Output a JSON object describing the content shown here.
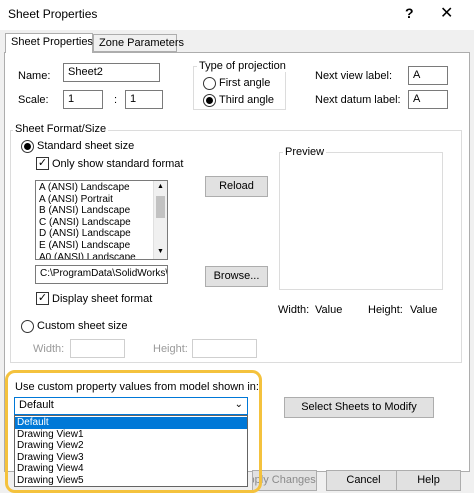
{
  "window": {
    "title": "Sheet Properties",
    "help_glyph": "?",
    "close_glyph": "✕"
  },
  "tabs": [
    {
      "label": "Sheet Properties"
    },
    {
      "label": "Zone Parameters"
    }
  ],
  "name": {
    "label": "Name:",
    "value": "Sheet2"
  },
  "scale": {
    "label": "Scale:",
    "numerator": "1",
    "separator": ":",
    "denominator": "1"
  },
  "projection": {
    "title": "Type of projection",
    "first_angle": "First angle",
    "third_angle": "Third angle"
  },
  "next_view": {
    "label": "Next view label:",
    "value": "A"
  },
  "next_datum": {
    "label": "Next datum label:",
    "value": "A"
  },
  "sheet_format": {
    "title": "Sheet Format/Size",
    "standard_size": "Standard sheet size",
    "only_standard": "Only show standard format",
    "sizes": [
      "A (ANSI) Landscape",
      "A (ANSI) Portrait",
      "B (ANSI) Landscape",
      "C (ANSI) Landscape",
      "D (ANSI) Landscape",
      "E (ANSI) Landscape",
      "A0 (ANSI) Landscape"
    ],
    "reload": "Reload",
    "path": "C:\\ProgramData\\SolidWorks\\",
    "browse": "Browse...",
    "display_format": "Display sheet format",
    "custom_size": "Custom sheet size",
    "width_label": "Width:",
    "height_label": "Height:"
  },
  "preview": {
    "title": "Preview",
    "width_label": "Width:",
    "width_value": "Value",
    "height_label": "Height:",
    "height_value": "Value"
  },
  "custom_property": {
    "label": "Use custom property values from model shown in:",
    "selected": "Default",
    "options": [
      "Default",
      "Drawing View1",
      "Drawing View2",
      "Drawing View3",
      "Drawing View4",
      "Drawing View5"
    ]
  },
  "select_sheets": "Select Sheets to Modify",
  "footer": {
    "apply": "Apply Changes",
    "cancel": "Cancel",
    "help": "Help"
  }
}
